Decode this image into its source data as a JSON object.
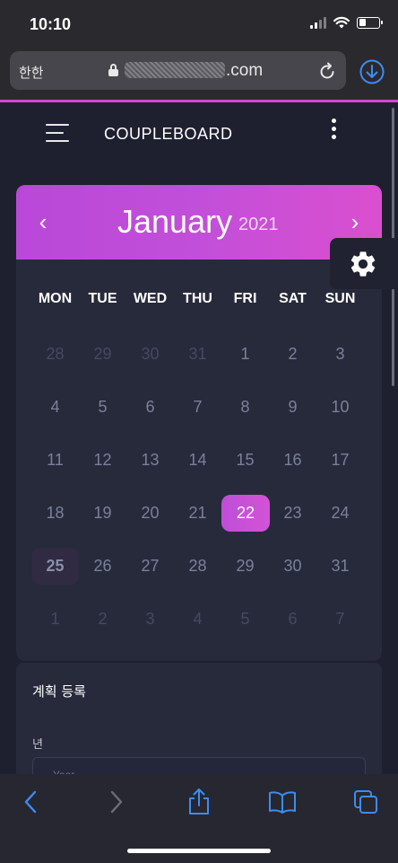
{
  "status_bar": {
    "time": "10:10"
  },
  "browser": {
    "lang_label": "한한",
    "domain": ".com"
  },
  "app": {
    "title": "COUPLEBOARD"
  },
  "calendar": {
    "prev": "‹",
    "next": "›",
    "month": "January",
    "year": "2021",
    "weekdays": [
      "MON",
      "TUE",
      "WED",
      "THU",
      "FRI",
      "SAT",
      "SUN"
    ],
    "weeks": [
      [
        "28",
        "29",
        "30",
        "31",
        "1",
        "2",
        "3"
      ],
      [
        "4",
        "5",
        "6",
        "7",
        "8",
        "9",
        "10"
      ],
      [
        "11",
        "12",
        "13",
        "14",
        "15",
        "16",
        "17"
      ],
      [
        "18",
        "19",
        "20",
        "21",
        "22",
        "23",
        "24"
      ],
      [
        "25",
        "26",
        "27",
        "28",
        "29",
        "30",
        "31"
      ],
      [
        "1",
        "2",
        "3",
        "4",
        "5",
        "6",
        "7"
      ]
    ],
    "selected_day": "22",
    "current_day": "25"
  },
  "plan_form": {
    "title": "계획 등록",
    "year_label": "년",
    "year_placeholder": "Year"
  }
}
